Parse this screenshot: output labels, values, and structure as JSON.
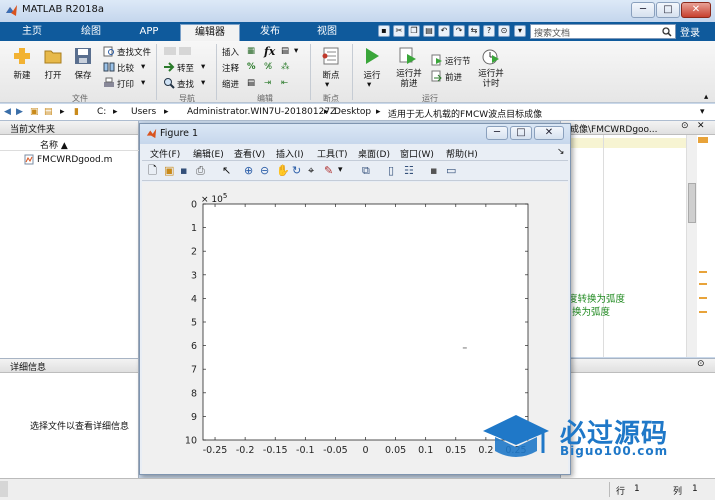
{
  "window": {
    "title": "MATLAB R2018a",
    "min": "─",
    "max": "□",
    "close": "✕"
  },
  "ribbon_tabs": [
    "主页",
    "绘图",
    "APP",
    "编辑器",
    "发布",
    "视图"
  ],
  "search": {
    "placeholder": "搜索文档"
  },
  "login": "登录",
  "ribbon": {
    "file": {
      "new": "新建",
      "open": "打开",
      "save": "保存",
      "find_files": "查找文件",
      "compare": "比较",
      "print": "打印",
      "title": "文件"
    },
    "navigate": {
      "goto": "转至",
      "find": "查找",
      "title": "导航"
    },
    "edit": {
      "insert": "插入",
      "comment": "注释",
      "indent": "缩进",
      "fx": "fx",
      "title": "编辑"
    },
    "breakpoints": {
      "breakpoints": "断点",
      "title": "断点"
    },
    "run": {
      "run": "运行",
      "run_advance": "运行并\n前进",
      "run_section": "运行节",
      "advance": "前进",
      "run_time": "运行并\n计时",
      "title": "运行"
    }
  },
  "path": {
    "drive": "C:",
    "parts": [
      "Users",
      "Administrator.WIN7U-20180127Z",
      "Desktop",
      "适用于无人机载的FMCW波点目标成像"
    ]
  },
  "current_folder": {
    "title": "当前文件夹",
    "column": "名称 ▲",
    "files": [
      "FMCWRDgood.m"
    ]
  },
  "details": {
    "title": "详细信息",
    "message": "选择文件以查看详细信息"
  },
  "editor": {
    "path_tail": "标成像\\FMCWRDgoo...",
    "lines": [
      "度转换为弧度",
      "换为弧度"
    ]
  },
  "figure": {
    "title": "Figure 1",
    "menu": [
      "文件(F)",
      "编辑(E)",
      "查看(V)",
      "插入(I)",
      "工具(T)",
      "桌面(D)",
      "窗口(W)",
      "帮助(H)"
    ],
    "exponent": "× 10",
    "exponent_power": "5"
  },
  "chart_data": {
    "type": "scatter",
    "x_ticks": [
      "-0.25",
      "-0.2",
      "-0.15",
      "-0.1",
      "-0.05",
      "0",
      "0.05",
      "0.1",
      "0.15",
      "0.2",
      "0.25"
    ],
    "y_ticks": [
      "0",
      "1",
      "2",
      "3",
      "4",
      "5",
      "6",
      "7",
      "8",
      "9",
      "10"
    ],
    "xlim": [
      -0.27,
      0.27
    ],
    "ylim": [
      0,
      10
    ],
    "y_reversed": true,
    "points": [
      {
        "x": 0.165,
        "y": 6.1
      }
    ],
    "grid": false
  },
  "status": {
    "row_label": "行",
    "row": "1",
    "col_label": "列",
    "col": "1"
  },
  "watermark": {
    "cn": "必过源码",
    "en": "Biguo100.com"
  },
  "colors": {
    "ribbon_blue": "#0f5a9c",
    "comment_green": "#228b22",
    "watermark_blue": "#1f78c8"
  }
}
